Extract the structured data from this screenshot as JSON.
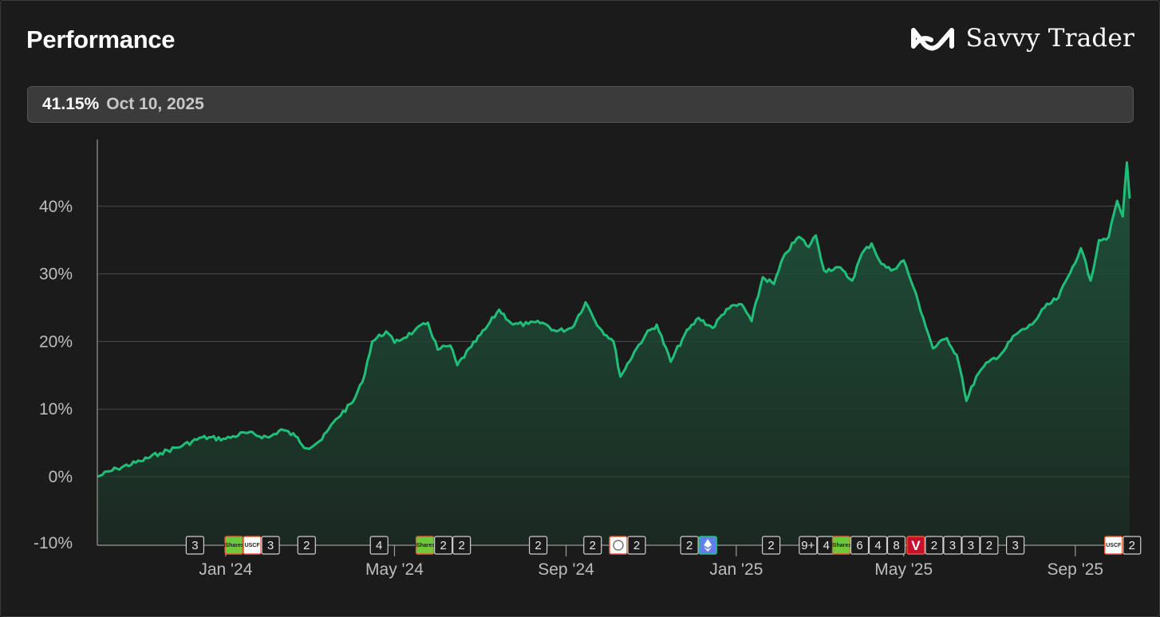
{
  "header": {
    "title": "Performance",
    "brand_name": "Savvy Trader",
    "brand_icon": "infinity-logo-icon"
  },
  "tooltip": {
    "value": "41.15%",
    "date": "Oct 10, 2025"
  },
  "colors": {
    "line": "#1fbf7a",
    "fill_top": "#1f5a40",
    "fill_bottom": "#1b2a22",
    "grid": "#4a4a4a",
    "background": "#1b1b1b"
  },
  "chart_data": {
    "type": "area",
    "title": "Performance",
    "xlabel": "",
    "ylabel": "",
    "ylim": [
      -10,
      50
    ],
    "y_ticks": [
      -10,
      0,
      10,
      20,
      30,
      40
    ],
    "y_tick_labels": [
      "-10%",
      "0%",
      "10%",
      "20%",
      "30%",
      "40%"
    ],
    "x_range": [
      "2023-10-01",
      "2025-10-10"
    ],
    "x_ticks": [
      {
        "date": "2024-01-01",
        "label": "Jan '24"
      },
      {
        "date": "2024-05-01",
        "label": "May '24"
      },
      {
        "date": "2024-09-01",
        "label": "Sep '24"
      },
      {
        "date": "2025-01-01",
        "label": "Jan '25"
      },
      {
        "date": "2025-05-01",
        "label": "May '25"
      },
      {
        "date": "2025-09-01",
        "label": "Sep '25"
      }
    ],
    "grid": "horizontal",
    "series": [
      {
        "points": [
          [
            "2023-10-01",
            0.0
          ],
          [
            "2023-10-15",
            1.2
          ],
          [
            "2023-11-01",
            2.3
          ],
          [
            "2023-11-15",
            3.5
          ],
          [
            "2023-12-01",
            4.6
          ],
          [
            "2023-12-15",
            5.8
          ],
          [
            "2024-01-01",
            5.6
          ],
          [
            "2024-01-15",
            6.5
          ],
          [
            "2024-02-01",
            5.8
          ],
          [
            "2024-02-10",
            7.0
          ],
          [
            "2024-02-20",
            6.0
          ],
          [
            "2024-02-28",
            4.2
          ],
          [
            "2024-03-10",
            5.5
          ],
          [
            "2024-03-20",
            8.5
          ],
          [
            "2024-04-01",
            11.0
          ],
          [
            "2024-04-08",
            14.0
          ],
          [
            "2024-04-15",
            20.0
          ],
          [
            "2024-04-25",
            21.5
          ],
          [
            "2024-05-01",
            19.8
          ],
          [
            "2024-05-15",
            21.5
          ],
          [
            "2024-05-25",
            22.8
          ],
          [
            "2024-06-01",
            18.8
          ],
          [
            "2024-06-10",
            19.4
          ],
          [
            "2024-06-15",
            16.5
          ],
          [
            "2024-06-25",
            19.2
          ],
          [
            "2024-07-05",
            21.8
          ],
          [
            "2024-07-15",
            24.7
          ],
          [
            "2024-07-25",
            22.5
          ],
          [
            "2024-08-05",
            22.6
          ],
          [
            "2024-08-15",
            22.8
          ],
          [
            "2024-08-25",
            21.5
          ],
          [
            "2024-09-05",
            22.0
          ],
          [
            "2024-09-15",
            25.8
          ],
          [
            "2024-09-25",
            22.0
          ],
          [
            "2024-10-05",
            20.0
          ],
          [
            "2024-10-10",
            14.8
          ],
          [
            "2024-10-20",
            18.5
          ],
          [
            "2024-10-28",
            21.0
          ],
          [
            "2024-11-05",
            22.5
          ],
          [
            "2024-11-15",
            17.0
          ],
          [
            "2024-11-25",
            21.0
          ],
          [
            "2024-12-05",
            23.5
          ],
          [
            "2024-12-15",
            22.0
          ],
          [
            "2024-12-25",
            24.8
          ],
          [
            "2025-01-05",
            25.5
          ],
          [
            "2025-01-12",
            23.0
          ],
          [
            "2025-01-20",
            29.5
          ],
          [
            "2025-01-28",
            28.5
          ],
          [
            "2025-02-05",
            33.0
          ],
          [
            "2025-02-15",
            35.5
          ],
          [
            "2025-02-22",
            34.0
          ],
          [
            "2025-02-27",
            35.7
          ],
          [
            "2025-03-05",
            30.5
          ],
          [
            "2025-03-15",
            31.0
          ],
          [
            "2025-03-25",
            29.0
          ],
          [
            "2025-04-01",
            33.0
          ],
          [
            "2025-04-08",
            34.5
          ],
          [
            "2025-04-15",
            31.5
          ],
          [
            "2025-04-22",
            30.5
          ],
          [
            "2025-05-01",
            32.0
          ],
          [
            "2025-05-08",
            28.0
          ],
          [
            "2025-05-15",
            23.5
          ],
          [
            "2025-05-22",
            19.0
          ],
          [
            "2025-06-01",
            20.5
          ],
          [
            "2025-06-08",
            18.0
          ],
          [
            "2025-06-12",
            14.5
          ],
          [
            "2025-06-15",
            11.2
          ],
          [
            "2025-06-22",
            14.8
          ],
          [
            "2025-07-01",
            17.0
          ],
          [
            "2025-07-10",
            18.2
          ],
          [
            "2025-07-20",
            21.0
          ],
          [
            "2025-08-01",
            22.5
          ],
          [
            "2025-08-10",
            25.0
          ],
          [
            "2025-08-20",
            26.5
          ],
          [
            "2025-08-30",
            31.0
          ],
          [
            "2025-09-05",
            33.8
          ],
          [
            "2025-09-12",
            29.0
          ],
          [
            "2025-09-18",
            35.0
          ],
          [
            "2025-09-25",
            35.5
          ],
          [
            "2025-10-01",
            40.8
          ],
          [
            "2025-10-05",
            38.5
          ],
          [
            "2025-10-08",
            46.5
          ],
          [
            "2025-10-10",
            41.15
          ]
        ]
      }
    ],
    "markers": [
      {
        "date": "2023-12-10",
        "items": [
          {
            "kind": "count",
            "text": "3"
          }
        ]
      },
      {
        "date": "2024-01-20",
        "items": [
          {
            "kind": "logo",
            "icon": "ishares-logo-icon",
            "bg": "#6fc73a",
            "text": "iShares"
          },
          {
            "kind": "logo",
            "icon": "uscf-logo-icon",
            "bg": "#ffffff",
            "text": "USCF"
          },
          {
            "kind": "count",
            "text": "3"
          }
        ]
      },
      {
        "date": "2024-02-28",
        "items": [
          {
            "kind": "count",
            "text": "2"
          }
        ]
      },
      {
        "date": "2024-04-20",
        "items": [
          {
            "kind": "count",
            "text": "4"
          }
        ]
      },
      {
        "date": "2024-06-05",
        "items": [
          {
            "kind": "logo",
            "icon": "ishares-logo-icon",
            "bg": "#6fc73a",
            "text": "iShares"
          },
          {
            "kind": "count",
            "text": "2"
          },
          {
            "kind": "count",
            "text": "2"
          }
        ]
      },
      {
        "date": "2024-08-12",
        "items": [
          {
            "kind": "count",
            "text": "2"
          }
        ]
      },
      {
        "date": "2024-09-20",
        "items": [
          {
            "kind": "count",
            "text": "2"
          }
        ]
      },
      {
        "date": "2024-10-15",
        "items": [
          {
            "kind": "logo",
            "icon": "circle-logo-icon",
            "bg": "#ffffff",
            "text": ""
          },
          {
            "kind": "count",
            "text": "2"
          }
        ]
      },
      {
        "date": "2024-12-05",
        "items": [
          {
            "kind": "count",
            "text": "2"
          },
          {
            "kind": "logo",
            "icon": "ethereum-logo-icon",
            "bg": "#627eea",
            "text": ""
          }
        ]
      },
      {
        "date": "2025-01-26",
        "items": [
          {
            "kind": "count",
            "text": "2"
          }
        ]
      },
      {
        "date": "2025-02-28",
        "items": [
          {
            "kind": "count",
            "text": "9+"
          },
          {
            "kind": "count",
            "text": "4"
          }
        ]
      },
      {
        "date": "2025-04-06",
        "items": [
          {
            "kind": "logo",
            "icon": "ishares-logo-icon",
            "bg": "#6fc73a",
            "text": "iShares"
          },
          {
            "kind": "count",
            "text": "6"
          },
          {
            "kind": "count",
            "text": "4"
          },
          {
            "kind": "count",
            "text": "8"
          }
        ]
      },
      {
        "date": "2025-06-05",
        "items": [
          {
            "kind": "logo",
            "icon": "v-logo-icon",
            "bg": "#c8102e",
            "text": "V"
          },
          {
            "kind": "count",
            "text": "2"
          },
          {
            "kind": "count",
            "text": "3"
          },
          {
            "kind": "count",
            "text": "3"
          },
          {
            "kind": "count",
            "text": "2"
          }
        ]
      },
      {
        "date": "2025-07-20",
        "items": [
          {
            "kind": "count",
            "text": "3"
          }
        ]
      },
      {
        "date": "2025-10-05",
        "items": [
          {
            "kind": "logo",
            "icon": "uscf-logo-icon",
            "bg": "#ffffff",
            "text": "USCF"
          },
          {
            "kind": "count",
            "text": "2"
          }
        ]
      }
    ]
  }
}
